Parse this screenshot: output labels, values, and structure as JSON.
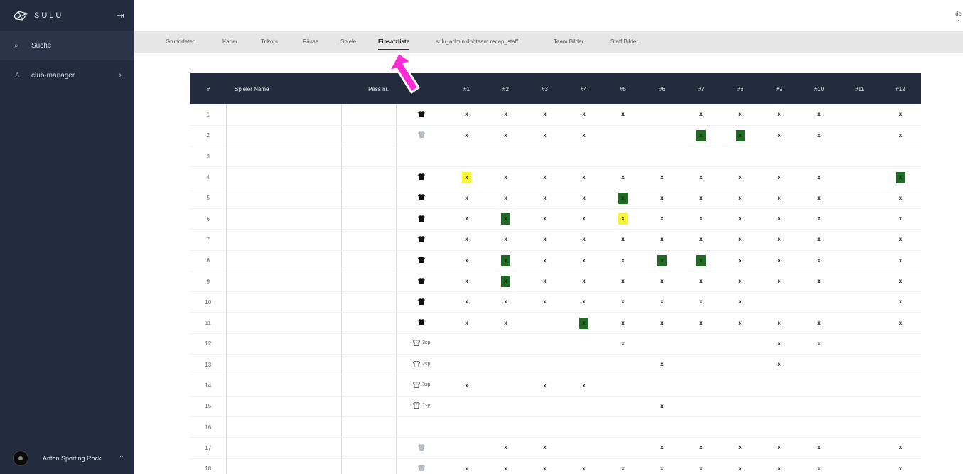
{
  "app": {
    "brand": "SULU",
    "collapse_icon": "collapse-sidebar-icon"
  },
  "sidebar": {
    "items": [
      {
        "icon": "search-icon",
        "label": "Suche"
      },
      {
        "icon": "user-icon",
        "label": "club-manager"
      }
    ],
    "footer_user": "Anton Sporting Rock"
  },
  "topbar": {
    "locale": "de"
  },
  "tabs": [
    {
      "label": "Grunddaten",
      "active": false
    },
    {
      "label": "Kader",
      "active": false
    },
    {
      "label": "Trikots",
      "active": false
    },
    {
      "label": "Pässe",
      "active": false
    },
    {
      "label": "Spiele",
      "active": false
    },
    {
      "label": "Einsatzliste",
      "active": true
    },
    {
      "label": "sulu_admin.dhbteam.recap_staff",
      "active": false
    },
    {
      "label": "Team Bilder",
      "active": false
    },
    {
      "label": "Staff Bilder",
      "active": false
    }
  ],
  "table": {
    "columns": [
      "#",
      "Spieler Name",
      "Pass nr.",
      "",
      "#1",
      "#2",
      "#3",
      "#4",
      "#5",
      "#6",
      "#7",
      "#8",
      "#9",
      "#10",
      "#11",
      "#12"
    ],
    "rows": [
      {
        "n": "1",
        "shirt": "black",
        "shirt_label": "",
        "cells": [
          "x",
          "x",
          "x",
          "x",
          "x",
          "",
          "x",
          "x",
          "x",
          "x",
          "",
          "x"
        ]
      },
      {
        "n": "2",
        "shirt": "grey",
        "shirt_label": "",
        "cells": [
          "x",
          "x",
          "x",
          "x",
          "",
          "",
          "G",
          "G",
          "x",
          "x",
          "",
          "x"
        ]
      },
      {
        "n": "3",
        "shirt": "none",
        "shirt_label": "",
        "cells": [
          "",
          "",
          "",
          "",
          "",
          "",
          "",
          "",
          "",
          "",
          "",
          ""
        ]
      },
      {
        "n": "4",
        "shirt": "black",
        "shirt_label": "",
        "cells": [
          "Y",
          "x",
          "x",
          "x",
          "x",
          "x",
          "x",
          "x",
          "x",
          "x",
          "",
          "G"
        ]
      },
      {
        "n": "5",
        "shirt": "black",
        "shirt_label": "",
        "cells": [
          "x",
          "x",
          "x",
          "x",
          "G",
          "x",
          "x",
          "x",
          "x",
          "x",
          "",
          "x"
        ]
      },
      {
        "n": "6",
        "shirt": "black",
        "shirt_label": "",
        "cells": [
          "x",
          "G",
          "x",
          "x",
          "Y",
          "x",
          "x",
          "x",
          "x",
          "x",
          "",
          "x"
        ]
      },
      {
        "n": "7",
        "shirt": "black",
        "shirt_label": "",
        "cells": [
          "x",
          "x",
          "x",
          "x",
          "x",
          "x",
          "x",
          "x",
          "x",
          "x",
          "",
          "x"
        ]
      },
      {
        "n": "8",
        "shirt": "black",
        "shirt_label": "",
        "cells": [
          "x",
          "G",
          "x",
          "x",
          "x",
          "G",
          "G",
          "x",
          "x",
          "x",
          "",
          "x"
        ]
      },
      {
        "n": "9",
        "shirt": "black",
        "shirt_label": "",
        "cells": [
          "x",
          "G",
          "x",
          "x",
          "x",
          "x",
          "x",
          "x",
          "x",
          "x",
          "",
          "x"
        ]
      },
      {
        "n": "10",
        "shirt": "black",
        "shirt_label": "",
        "cells": [
          "x",
          "x",
          "x",
          "x",
          "x",
          "x",
          "x",
          "x",
          "",
          "",
          "",
          "x"
        ]
      },
      {
        "n": "11",
        "shirt": "black",
        "shirt_label": "",
        "cells": [
          "x",
          "x",
          "",
          "G",
          "x",
          "x",
          "x",
          "x",
          "x",
          "x",
          "",
          "x"
        ]
      },
      {
        "n": "12",
        "shirt": "outline",
        "shirt_label": "3sp",
        "cells": [
          "",
          "",
          "",
          "",
          "x",
          "",
          "",
          "",
          "x",
          "x",
          "",
          ""
        ]
      },
      {
        "n": "13",
        "shirt": "outline",
        "shirt_label": "2sp",
        "cells": [
          "",
          "",
          "",
          "",
          "",
          "x",
          "",
          "",
          "x",
          "",
          "",
          ""
        ]
      },
      {
        "n": "14",
        "shirt": "outline",
        "shirt_label": "3sp",
        "cells": [
          "x",
          "",
          "x",
          "x",
          "",
          "",
          "",
          "",
          "",
          "",
          "",
          ""
        ]
      },
      {
        "n": "15",
        "shirt": "outline",
        "shirt_label": "1sp",
        "cells": [
          "",
          "",
          "",
          "",
          "",
          "x",
          "",
          "",
          "",
          "",
          "",
          ""
        ]
      },
      {
        "n": "16",
        "shirt": "none",
        "shirt_label": "",
        "cells": [
          "",
          "",
          "",
          "",
          "",
          "",
          "",
          "",
          "",
          "",
          "",
          ""
        ]
      },
      {
        "n": "17",
        "shirt": "grey",
        "shirt_label": "",
        "cells": [
          "",
          "x",
          "x",
          "",
          "",
          "x",
          "x",
          "x",
          "x",
          "x",
          "",
          "x"
        ]
      },
      {
        "n": "18",
        "shirt": "grey",
        "shirt_label": "",
        "cells": [
          "x",
          "x",
          "x",
          "x",
          "x",
          "x",
          "x",
          "x",
          "x",
          "x",
          "",
          "x"
        ]
      }
    ]
  },
  "colors": {
    "sidebar_bg": "#232c3f",
    "header_bg": "#232c3f",
    "green_mark": "#1f6b24",
    "yellow_mark": "#f7f33a",
    "annotation_arrow": "#ff2bd6"
  }
}
